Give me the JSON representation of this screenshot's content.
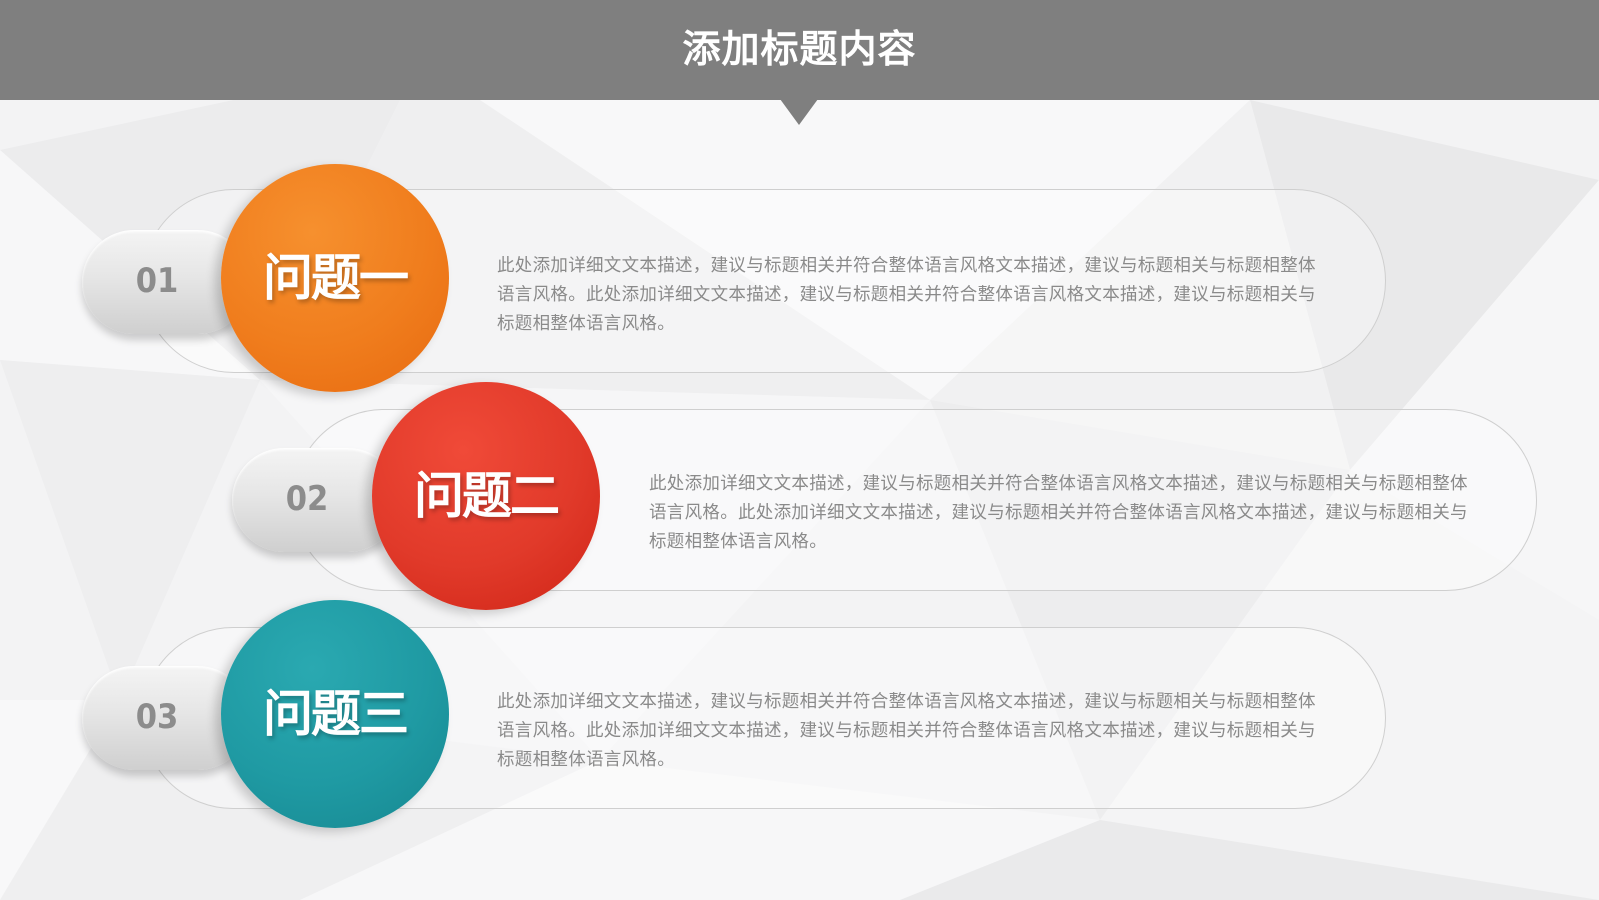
{
  "header": {
    "title": "添加标题内容"
  },
  "colors": {
    "header": "#7f7f7f",
    "item1": "#f07d1d",
    "item2": "#e13a2a",
    "item3": "#1f9aa3"
  },
  "items": [
    {
      "number": "01",
      "label": "问题一",
      "description": "此处添加详细文文本描述，建议与标题相关并符合整体语言风格文本描述，建议与标题相关与标题相整体语言风格。此处添加详细文文本描述，建议与标题相关并符合整体语言风格文本描述，建议与标题相关与标题相整体语言风格。"
    },
    {
      "number": "02",
      "label": "问题二",
      "description": "此处添加详细文文本描述，建议与标题相关并符合整体语言风格文本描述，建议与标题相关与标题相整体语言风格。此处添加详细文文本描述，建议与标题相关并符合整体语言风格文本描述，建议与标题相关与标题相整体语言风格。"
    },
    {
      "number": "03",
      "label": "问题三",
      "description": "此处添加详细文文本描述，建议与标题相关并符合整体语言风格文本描述，建议与标题相关与标题相整体语言风格。此处添加详细文文本描述，建议与标题相关并符合整体语言风格文本描述，建议与标题相关与标题相整体语言风格。"
    }
  ]
}
